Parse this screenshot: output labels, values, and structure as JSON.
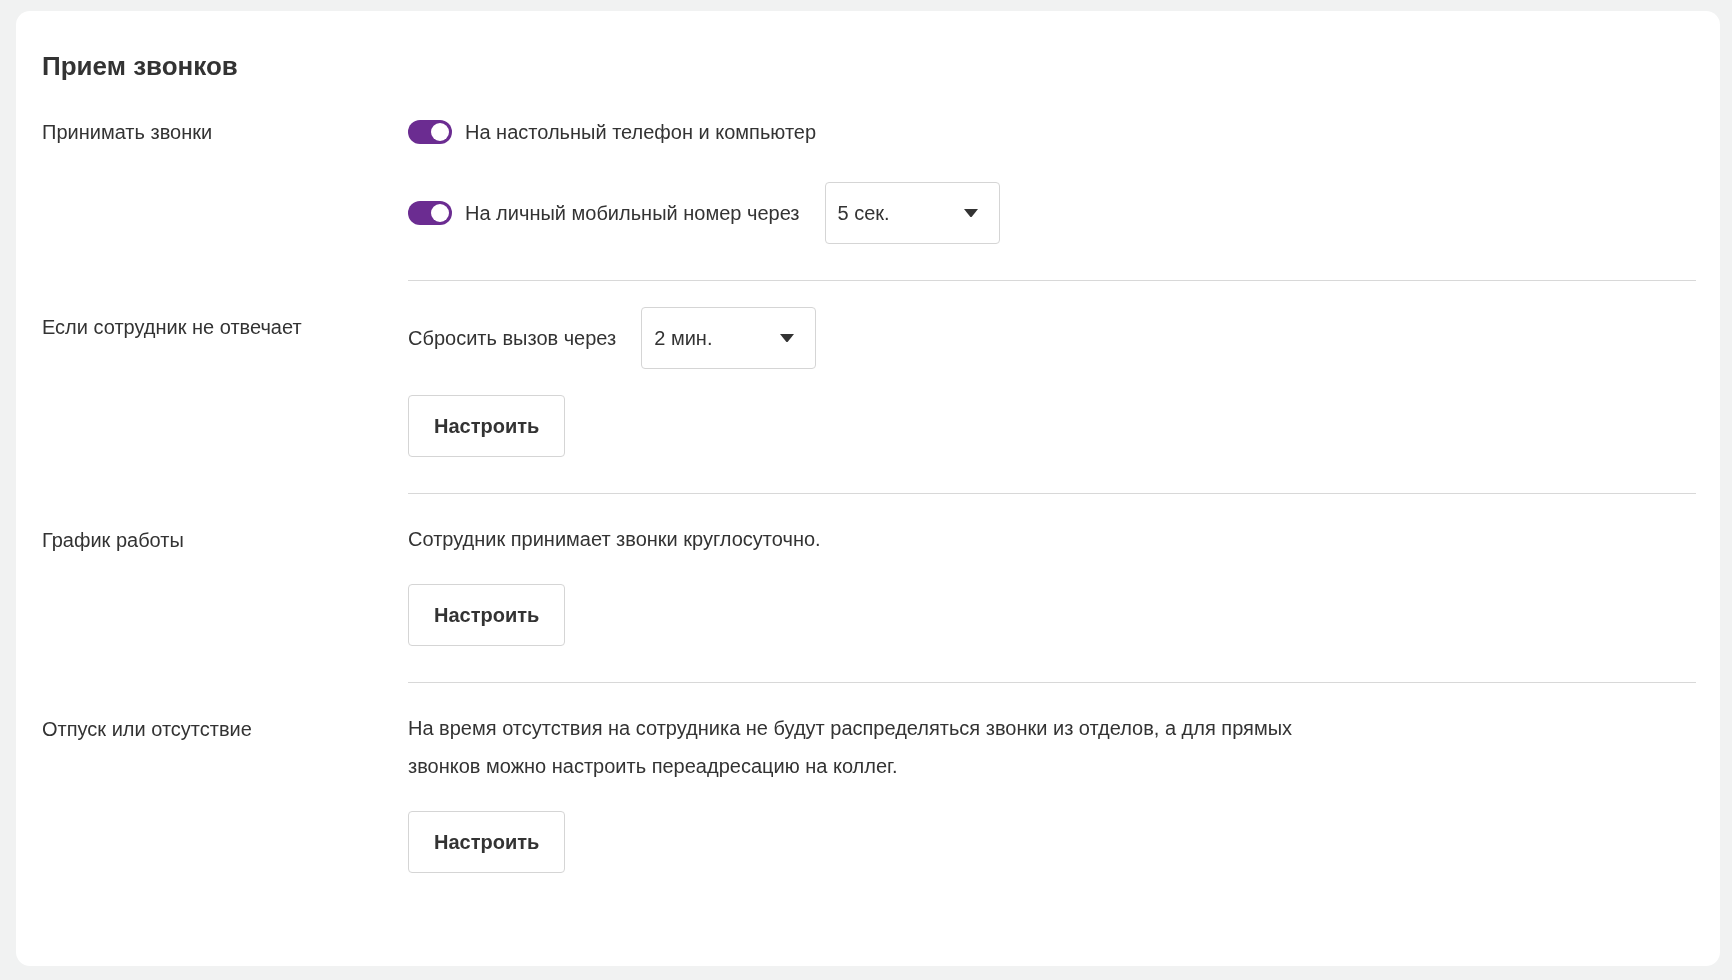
{
  "title": "Прием звонков",
  "sections": [
    {
      "label": "Принимать звонки",
      "rows": [
        {
          "kind": "toggle",
          "on": true,
          "label": "На настольный телефон и компьютер"
        },
        {
          "kind": "toggle",
          "on": true,
          "label": "На личный мобильный номер через",
          "dropdown": "5 сек."
        }
      ]
    },
    {
      "label": "Если сотрудник не отвечает",
      "rows": [
        {
          "kind": "select",
          "label": "Сбросить вызов через",
          "dropdown": "2 мин."
        },
        {
          "kind": "button",
          "label": "Настроить"
        }
      ]
    },
    {
      "label": "График работы",
      "rows": [
        {
          "kind": "text",
          "text": "Сотрудник принимает звонки круглосуточно."
        },
        {
          "kind": "button",
          "label": "Настроить"
        }
      ]
    },
    {
      "label": "Отпуск или отсутствие",
      "rows": [
        {
          "kind": "text",
          "text": "На время отсутствия на сотрудника не будут распределяться звонки из отделов, а для прямых звонков можно настроить переадресацию на коллег."
        },
        {
          "kind": "button",
          "label": "Настроить"
        }
      ]
    }
  ]
}
